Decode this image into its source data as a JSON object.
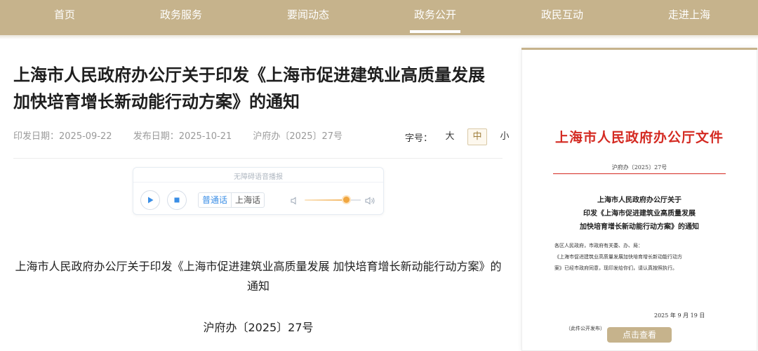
{
  "nav": {
    "items": [
      {
        "label": "首页"
      },
      {
        "label": "政务服务"
      },
      {
        "label": "要闻动态"
      },
      {
        "label": "政务公开"
      },
      {
        "label": "政民互动"
      },
      {
        "label": "走进上海"
      }
    ],
    "active_index": 3
  },
  "article": {
    "title": "上海市人民政府办公厅关于印发《上海市促进建筑业高质量发展 加快培育增长新动能行动方案》的通知",
    "issue_date": "印发日期：2025-09-22",
    "publish_date": "发布日期：2025-10-21",
    "doc_number": "沪府办〔2025〕27号",
    "font_size": {
      "label": "字号：",
      "options": [
        "大",
        "中",
        "小"
      ],
      "selected": "中"
    }
  },
  "player": {
    "title": "无障碍语音播报",
    "languages": [
      "普通话",
      "上海话"
    ],
    "selected_language": "普通话",
    "volume_level": 0.75
  },
  "body": {
    "title": "上海市人民政府办公厅关于印发《上海市促进建筑业高质量发展 加快培育增长新动能行动方案》的通知",
    "doc_number": "沪府办〔2025〕27号"
  },
  "doc_preview": {
    "header": "上海市人民政府办公厅文件",
    "header_no": "沪府办〔2025〕27号",
    "title_lines": [
      "上海市人民政府办公厅关于",
      "印发《上海市促进建筑业高质量发展",
      "加快培育增长新动能行动方案》的通知"
    ],
    "para_lines": [
      "各区人民政府，市政府有关委、办、局：",
      "《上海市促进建筑业高质量发展加快培育增长新动能行动方",
      "案》已经市政府同意，现印发给你们，请认真按照执行。"
    ],
    "date": "2025 年 9 月 19 日",
    "note": "（此件公开发布）",
    "view_button": "点击查看"
  },
  "colors": {
    "nav_bg": "#c6b38c",
    "doc_red": "#d42a22",
    "accent_blue": "#3a8ee6",
    "volume_orange": "#f0a640"
  }
}
